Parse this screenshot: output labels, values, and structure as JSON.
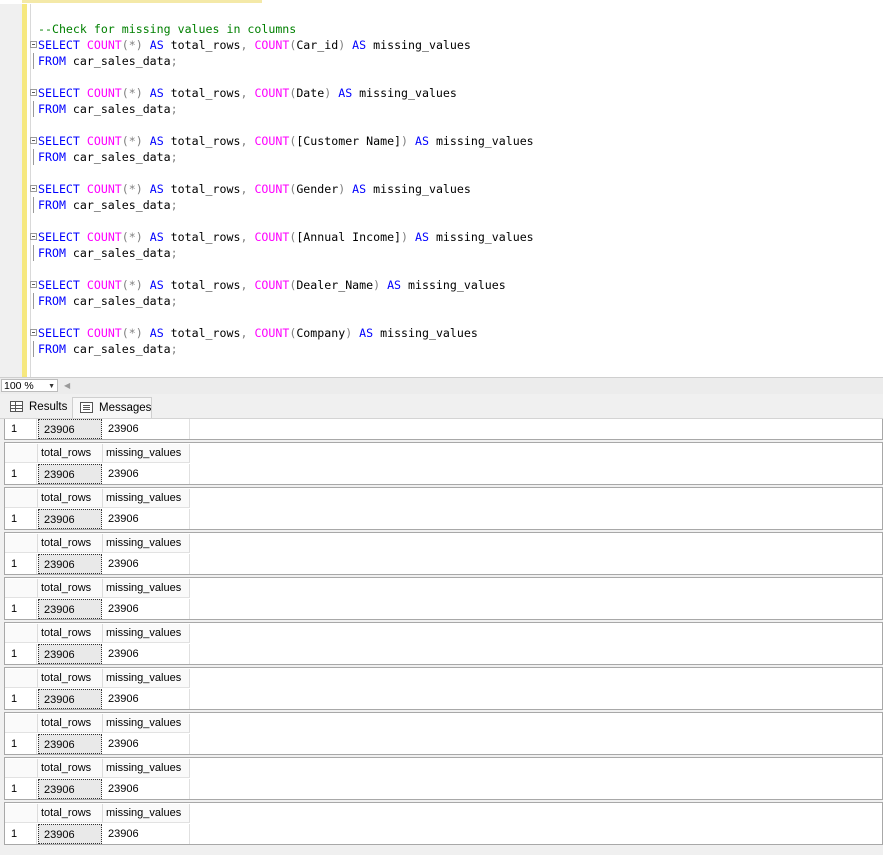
{
  "editor": {
    "lines": [
      {
        "fold": false,
        "tokens": [
          {
            "t": "--Check for missing values in columns",
            "c": "cm"
          }
        ]
      },
      {
        "fold": true,
        "tokens": [
          {
            "t": "SELECT ",
            "c": "kw"
          },
          {
            "t": "COUNT",
            "c": "fn"
          },
          {
            "t": "(*)",
            "c": "op"
          },
          {
            "t": " AS ",
            "c": "kw"
          },
          {
            "t": "total_rows",
            "c": ""
          },
          {
            "t": ", ",
            "c": "op"
          },
          {
            "t": "COUNT",
            "c": "fn"
          },
          {
            "t": "(",
            "c": "op"
          },
          {
            "t": "Car_id",
            "c": ""
          },
          {
            "t": ")",
            "c": "op"
          },
          {
            "t": " AS ",
            "c": "kw"
          },
          {
            "t": "missing_values",
            "c": ""
          }
        ]
      },
      {
        "fold": false,
        "cont": true,
        "tokens": [
          {
            "t": "FROM ",
            "c": "kw"
          },
          {
            "t": "car_sales_data",
            "c": ""
          },
          {
            "t": ";",
            "c": "op"
          }
        ]
      },
      {
        "fold": false,
        "tokens": []
      },
      {
        "fold": true,
        "tokens": [
          {
            "t": "SELECT ",
            "c": "kw"
          },
          {
            "t": "COUNT",
            "c": "fn"
          },
          {
            "t": "(*)",
            "c": "op"
          },
          {
            "t": " AS ",
            "c": "kw"
          },
          {
            "t": "total_rows",
            "c": ""
          },
          {
            "t": ", ",
            "c": "op"
          },
          {
            "t": "COUNT",
            "c": "fn"
          },
          {
            "t": "(",
            "c": "op"
          },
          {
            "t": "Date",
            "c": ""
          },
          {
            "t": ")",
            "c": "op"
          },
          {
            "t": " AS ",
            "c": "kw"
          },
          {
            "t": "missing_values",
            "c": ""
          }
        ]
      },
      {
        "fold": false,
        "cont": true,
        "tokens": [
          {
            "t": "FROM ",
            "c": "kw"
          },
          {
            "t": "car_sales_data",
            "c": ""
          },
          {
            "t": ";",
            "c": "op"
          }
        ]
      },
      {
        "fold": false,
        "tokens": []
      },
      {
        "fold": true,
        "tokens": [
          {
            "t": "SELECT ",
            "c": "kw"
          },
          {
            "t": "COUNT",
            "c": "fn"
          },
          {
            "t": "(*)",
            "c": "op"
          },
          {
            "t": " AS ",
            "c": "kw"
          },
          {
            "t": "total_rows",
            "c": ""
          },
          {
            "t": ", ",
            "c": "op"
          },
          {
            "t": "COUNT",
            "c": "fn"
          },
          {
            "t": "(",
            "c": "op"
          },
          {
            "t": "[Customer Name]",
            "c": ""
          },
          {
            "t": ")",
            "c": "op"
          },
          {
            "t": " AS ",
            "c": "kw"
          },
          {
            "t": "missing_values",
            "c": ""
          }
        ]
      },
      {
        "fold": false,
        "cont": true,
        "tokens": [
          {
            "t": "FROM ",
            "c": "kw"
          },
          {
            "t": "car_sales_data",
            "c": ""
          },
          {
            "t": ";",
            "c": "op"
          }
        ]
      },
      {
        "fold": false,
        "tokens": []
      },
      {
        "fold": true,
        "tokens": [
          {
            "t": "SELECT ",
            "c": "kw"
          },
          {
            "t": "COUNT",
            "c": "fn"
          },
          {
            "t": "(*)",
            "c": "op"
          },
          {
            "t": " AS ",
            "c": "kw"
          },
          {
            "t": "total_rows",
            "c": ""
          },
          {
            "t": ", ",
            "c": "op"
          },
          {
            "t": "COUNT",
            "c": "fn"
          },
          {
            "t": "(",
            "c": "op"
          },
          {
            "t": "Gender",
            "c": ""
          },
          {
            "t": ")",
            "c": "op"
          },
          {
            "t": " AS ",
            "c": "kw"
          },
          {
            "t": "missing_values",
            "c": ""
          }
        ]
      },
      {
        "fold": false,
        "cont": true,
        "tokens": [
          {
            "t": "FROM ",
            "c": "kw"
          },
          {
            "t": "car_sales_data",
            "c": ""
          },
          {
            "t": ";",
            "c": "op"
          }
        ]
      },
      {
        "fold": false,
        "tokens": []
      },
      {
        "fold": true,
        "tokens": [
          {
            "t": "SELECT ",
            "c": "kw"
          },
          {
            "t": "COUNT",
            "c": "fn"
          },
          {
            "t": "(*)",
            "c": "op"
          },
          {
            "t": " AS ",
            "c": "kw"
          },
          {
            "t": "total_rows",
            "c": ""
          },
          {
            "t": ", ",
            "c": "op"
          },
          {
            "t": "COUNT",
            "c": "fn"
          },
          {
            "t": "(",
            "c": "op"
          },
          {
            "t": "[Annual Income]",
            "c": ""
          },
          {
            "t": ")",
            "c": "op"
          },
          {
            "t": " AS ",
            "c": "kw"
          },
          {
            "t": "missing_values",
            "c": ""
          }
        ]
      },
      {
        "fold": false,
        "cont": true,
        "tokens": [
          {
            "t": "FROM ",
            "c": "kw"
          },
          {
            "t": "car_sales_data",
            "c": ""
          },
          {
            "t": ";",
            "c": "op"
          }
        ]
      },
      {
        "fold": false,
        "tokens": []
      },
      {
        "fold": true,
        "tokens": [
          {
            "t": "SELECT ",
            "c": "kw"
          },
          {
            "t": "COUNT",
            "c": "fn"
          },
          {
            "t": "(*)",
            "c": "op"
          },
          {
            "t": " AS ",
            "c": "kw"
          },
          {
            "t": "total_rows",
            "c": ""
          },
          {
            "t": ", ",
            "c": "op"
          },
          {
            "t": "COUNT",
            "c": "fn"
          },
          {
            "t": "(",
            "c": "op"
          },
          {
            "t": "Dealer_Name",
            "c": ""
          },
          {
            "t": ")",
            "c": "op"
          },
          {
            "t": " AS ",
            "c": "kw"
          },
          {
            "t": "missing_values",
            "c": ""
          }
        ]
      },
      {
        "fold": false,
        "cont": true,
        "tokens": [
          {
            "t": "FROM ",
            "c": "kw"
          },
          {
            "t": "car_sales_data",
            "c": ""
          },
          {
            "t": ";",
            "c": "op"
          }
        ]
      },
      {
        "fold": false,
        "tokens": []
      },
      {
        "fold": true,
        "tokens": [
          {
            "t": "SELECT ",
            "c": "kw"
          },
          {
            "t": "COUNT",
            "c": "fn"
          },
          {
            "t": "(*)",
            "c": "op"
          },
          {
            "t": " AS ",
            "c": "kw"
          },
          {
            "t": "total_rows",
            "c": ""
          },
          {
            "t": ", ",
            "c": "op"
          },
          {
            "t": "COUNT",
            "c": "fn"
          },
          {
            "t": "(",
            "c": "op"
          },
          {
            "t": "Company",
            "c": ""
          },
          {
            "t": ")",
            "c": "op"
          },
          {
            "t": " AS ",
            "c": "kw"
          },
          {
            "t": "missing_values",
            "c": ""
          }
        ]
      },
      {
        "fold": false,
        "cont": true,
        "tokens": [
          {
            "t": "FROM ",
            "c": "kw"
          },
          {
            "t": "car_sales_data",
            "c": ""
          },
          {
            "t": ";",
            "c": "op"
          }
        ]
      }
    ]
  },
  "statusbar": {
    "zoom": "100 %"
  },
  "tabs": {
    "results": "Results",
    "messages": "Messages"
  },
  "results": {
    "grids": [
      {
        "header": false,
        "columns": [],
        "row": [
          "1",
          "23906",
          "23906"
        ]
      },
      {
        "header": true,
        "columns": [
          "total_rows",
          "missing_values"
        ],
        "row": [
          "1",
          "23906",
          "23906"
        ]
      },
      {
        "header": true,
        "columns": [
          "total_rows",
          "missing_values"
        ],
        "row": [
          "1",
          "23906",
          "23906"
        ]
      },
      {
        "header": true,
        "columns": [
          "total_rows",
          "missing_values"
        ],
        "row": [
          "1",
          "23906",
          "23906"
        ]
      },
      {
        "header": true,
        "columns": [
          "total_rows",
          "missing_values"
        ],
        "row": [
          "1",
          "23906",
          "23906"
        ]
      },
      {
        "header": true,
        "columns": [
          "total_rows",
          "missing_values"
        ],
        "row": [
          "1",
          "23906",
          "23906"
        ]
      },
      {
        "header": true,
        "columns": [
          "total_rows",
          "missing_values"
        ],
        "row": [
          "1",
          "23906",
          "23906"
        ]
      },
      {
        "header": true,
        "columns": [
          "total_rows",
          "missing_values"
        ],
        "row": [
          "1",
          "23906",
          "23906"
        ]
      },
      {
        "header": true,
        "columns": [
          "total_rows",
          "missing_values"
        ],
        "row": [
          "1",
          "23906",
          "23906"
        ]
      },
      {
        "header": true,
        "columns": [
          "total_rows",
          "missing_values"
        ],
        "row": [
          "1",
          "23906",
          "23906"
        ]
      }
    ]
  }
}
